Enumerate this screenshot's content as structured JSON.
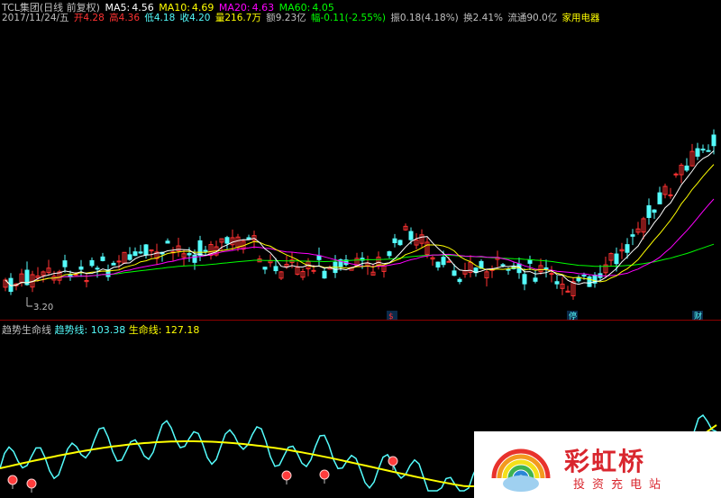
{
  "header": {
    "stock": "TCL集团(日线 前复权)",
    "ma5_label": "MA5:",
    "ma5": "4.56",
    "ma10_label": "MA10:",
    "ma10": "4.69",
    "ma20_label": "MA20:",
    "ma20": "4.63",
    "ma60_label": "MA60:",
    "ma60": "4.05",
    "date": "2017/11/24/五",
    "open_label": "开",
    "open": "4.28",
    "high_label": "高",
    "high": "4.36",
    "low_label": "低",
    "low": "4.18",
    "close_label": "收",
    "close": "4.20",
    "volume_label": "量",
    "volume": "216.7万",
    "amount_label": "额",
    "amount": "9.23亿",
    "change_label": "幅",
    "change": "-0.11(-2.55%)",
    "amplitude_label": "振",
    "amplitude": "0.18(4.18%)",
    "turnover_label": "换",
    "turnover": "2.41%",
    "float_label": "流通",
    "float": "90.0亿",
    "industry": "家用电器"
  },
  "price_markers": {
    "low_mark": "3.20"
  },
  "event_markers": [
    "$",
    "停",
    "财"
  ],
  "indicator": {
    "name": "趋势生命线",
    "trend_label": "趋势线:",
    "trend": "103.38",
    "life_label": "生命线:",
    "life": "127.18"
  },
  "watermark": {
    "title": "彩虹桥",
    "subtitle": "投资充电站"
  },
  "colors": {
    "up": "#ff3232",
    "down": "#54fcfc",
    "ma5": "#ffffff",
    "ma10": "#ffff00",
    "ma20": "#ff00ff",
    "ma60": "#00ff00",
    "trend": "#54fcfc",
    "life": "#ffff00"
  }
}
